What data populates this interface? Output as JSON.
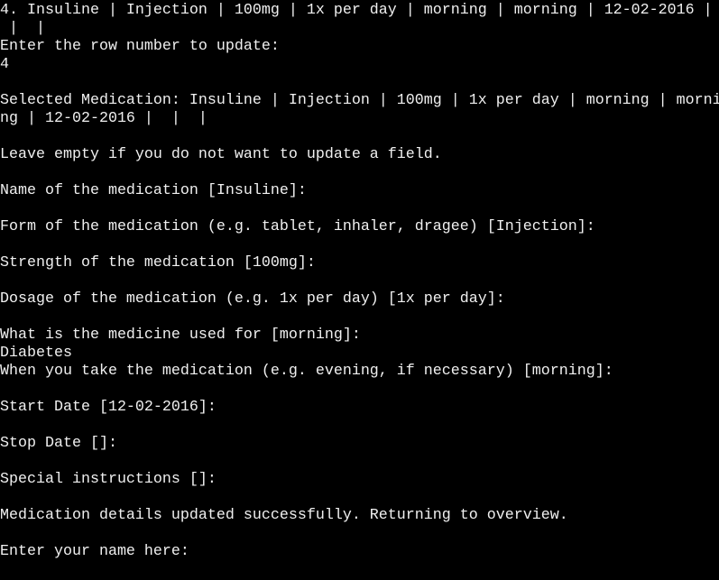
{
  "terminal": {
    "lines": [
      "4. Insuline | Injection | 100mg | 1x per day | morning | morning | 12-02-2016 |",
      " |  |",
      "Enter the row number to update:",
      "4",
      "",
      "Selected Medication: Insuline | Injection | 100mg | 1x per day | morning | morni",
      "ng | 12-02-2016 |  |  |",
      "",
      "Leave empty if you do not want to update a field.",
      "",
      "Name of the medication [Insuline]:",
      "",
      "Form of the medication (e.g. tablet, inhaler, dragee) [Injection]:",
      "",
      "Strength of the medication [100mg]:",
      "",
      "Dosage of the medication (e.g. 1x per day) [1x per day]:",
      "",
      "What is the medicine used for [morning]:",
      "Diabetes",
      "When you take the medication (e.g. evening, if necessary) [morning]:",
      "",
      "Start Date [12-02-2016]:",
      "",
      "Stop Date []:",
      "",
      "Special instructions []:",
      "",
      "Medication details updated successfully. Returning to overview.",
      "",
      "Enter your name here:"
    ],
    "input": ""
  },
  "colors": {
    "background": "#000000",
    "foreground": "#f0f0f0",
    "cursor": "#ffffff"
  }
}
